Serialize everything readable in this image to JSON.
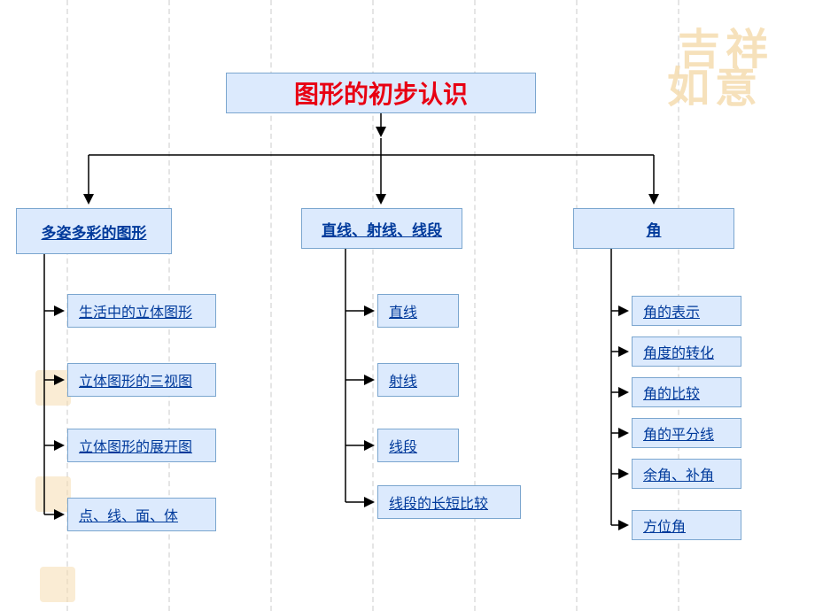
{
  "title": "图形的初步认识",
  "categories": {
    "a": {
      "label": "多姿多彩的图形",
      "items": [
        "生活中的立体图形",
        "立体图形的三视图",
        "立体图形的展开图",
        "点、线、面、体"
      ]
    },
    "b": {
      "label": "直线、射线、线段",
      "items": [
        "直线",
        "射线",
        "线段",
        "线段的长短比较"
      ]
    },
    "c": {
      "label": "角",
      "items": [
        "角的表示",
        "角度的转化",
        "角的比较",
        "角的平分线",
        "余角、补角",
        "方位角"
      ]
    }
  },
  "watermark": {
    "row1": "吉祥",
    "row2": "如意"
  }
}
